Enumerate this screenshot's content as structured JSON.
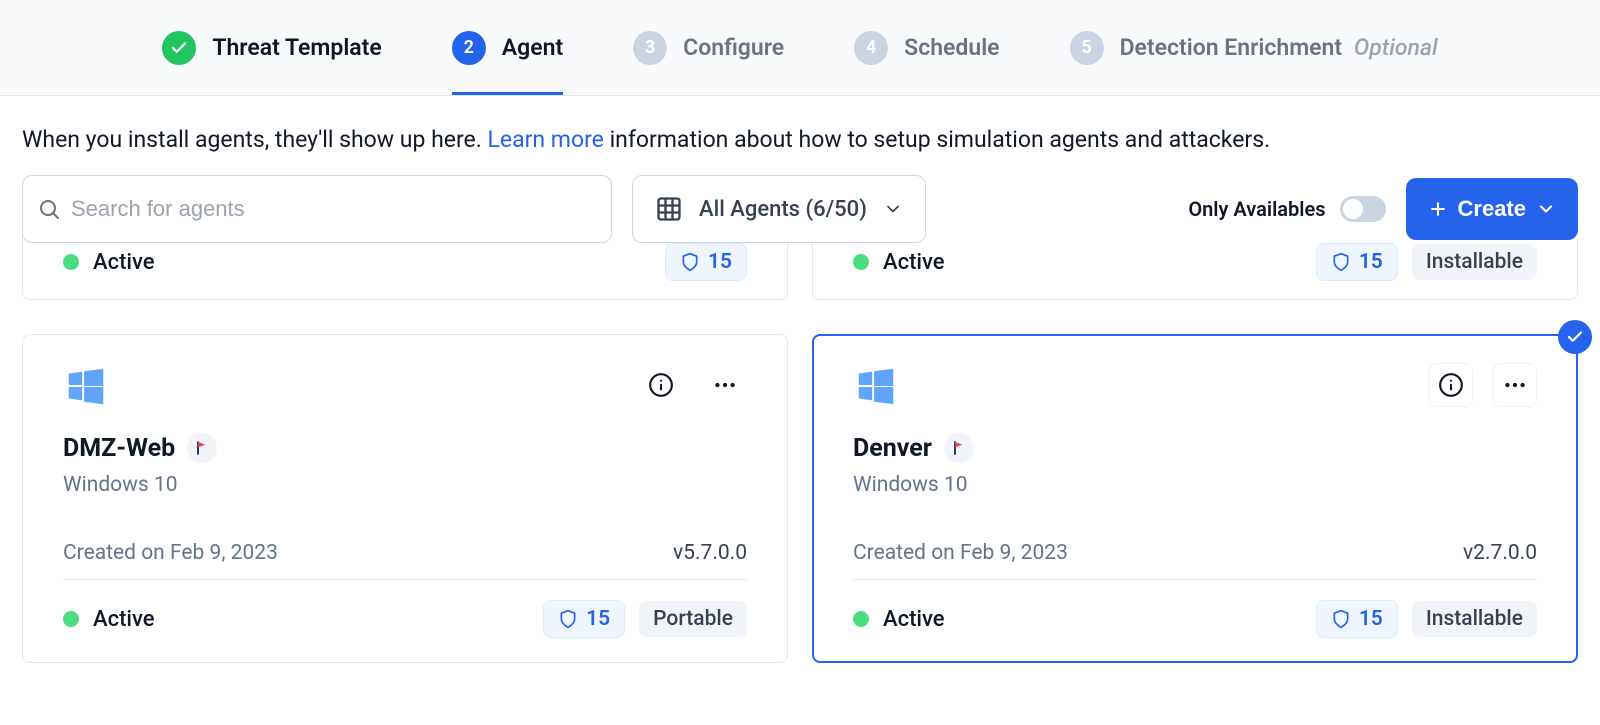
{
  "stepper": {
    "steps": [
      {
        "num": "",
        "label": "Threat Template",
        "state": "done"
      },
      {
        "num": "2",
        "label": "Agent",
        "state": "active"
      },
      {
        "num": "3",
        "label": "Configure",
        "state": "future"
      },
      {
        "num": "4",
        "label": "Schedule",
        "state": "future"
      },
      {
        "num": "5",
        "label": "Detection Enrichment",
        "state": "future",
        "optional": "Optional"
      }
    ]
  },
  "info": {
    "prefix": "When you install agents, they'll show up here. ",
    "link": "Learn more",
    "suffix": " information about how to setup simulation agents and attackers."
  },
  "controls": {
    "search_placeholder": "Search for agents",
    "filter_label": "All Agents (6/50)",
    "only_availables_label": "Only Availables",
    "only_availables_on": false,
    "create_label": "Create"
  },
  "stubs": [
    {
      "status": "Active",
      "shield": "15",
      "tag": ""
    },
    {
      "status": "Active",
      "shield": "15",
      "tag": "Installable"
    }
  ],
  "agents": [
    {
      "name": "DMZ-Web",
      "os": "Windows 10",
      "created": "Created on Feb 9, 2023",
      "version": "v5.7.0.0",
      "status": "Active",
      "shield": "15",
      "tag": "Portable",
      "selected": false
    },
    {
      "name": "Denver",
      "os": "Windows 10",
      "created": "Created on Feb 9, 2023",
      "version": "v2.7.0.0",
      "status": "Active",
      "shield": "15",
      "tag": "Installable",
      "selected": true
    }
  ]
}
